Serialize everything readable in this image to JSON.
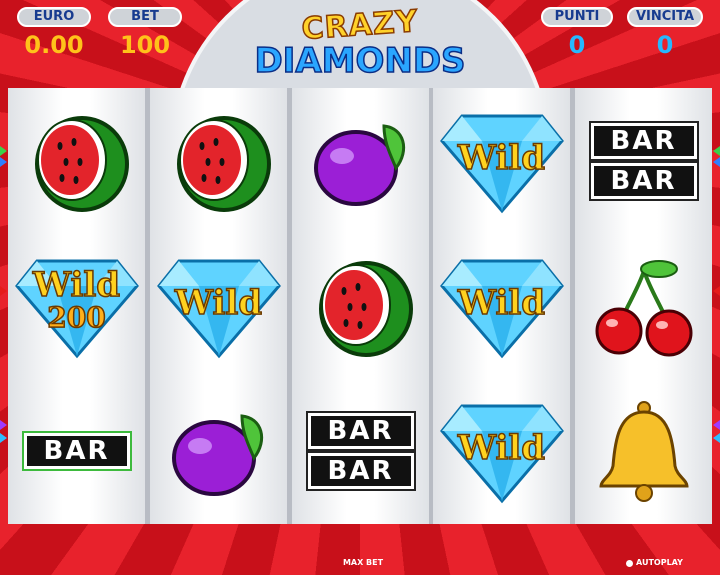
{
  "hud": {
    "euro_label": "EURO",
    "euro_value": "0.00",
    "bet_label": "BET",
    "bet_value": "100",
    "punti_label": "PUNTI",
    "punti_value": "0",
    "vincita_label": "VINCITA",
    "vincita_value": "0"
  },
  "logo": {
    "line1": "CRAZY",
    "line2": "DIAMONDS"
  },
  "reels": [
    [
      "watermelon",
      "wild-diamond",
      "bar"
    ],
    [
      "watermelon",
      "wild-diamond",
      "plum"
    ],
    [
      "plum",
      "watermelon",
      "double-bar"
    ],
    [
      "wild-diamond",
      "wild-diamond",
      "wild-diamond"
    ],
    [
      "double-bar",
      "cherries",
      "bell"
    ]
  ],
  "symbols": {
    "wild": "Wild",
    "bar": "BAR",
    "win_amount": "200"
  },
  "footer": {
    "max_bet": "MAX BET",
    "autoplay": "AUTOPLAY"
  },
  "colors": {
    "background_red": "#d8141f",
    "reel_white": "#ffffff",
    "hud_blue": "#173b8f",
    "value_yellow": "#ffc21a",
    "value_blue": "#26b8ff"
  }
}
